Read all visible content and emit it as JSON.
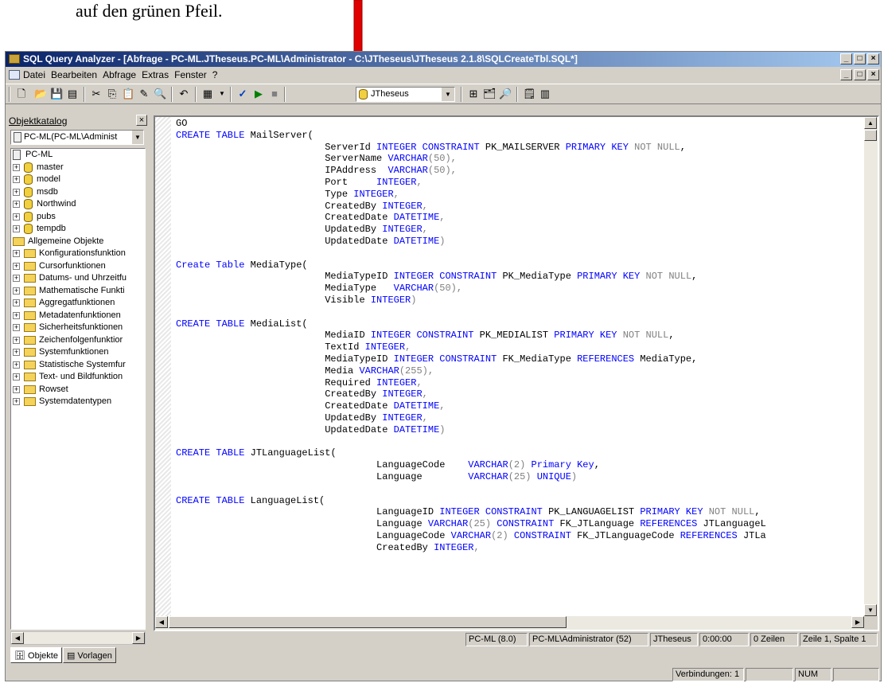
{
  "caption": "auf den grünen Pfeil.",
  "colors": {
    "arrow": "#e00000",
    "title_start": "#0a246a",
    "title_end": "#a6caf0",
    "keyword": "#0000ff"
  },
  "window": {
    "title": "SQL Query Analyzer - [Abfrage - PC-ML.JTheseus.PC-ML\\Administrator - C:\\JTheseus\\JTheseus 2.1.8\\SQLCreateTbl.SQL*]",
    "caption_buttons": [
      "_",
      "□",
      "×"
    ]
  },
  "menu": {
    "items": [
      "Datei",
      "Bearbeiten",
      "Abfrage",
      "Extras",
      "Fenster",
      "?"
    ]
  },
  "toolbar": {
    "database": "JTheseus"
  },
  "object_browser": {
    "title": "Objektkatalog",
    "close": "×",
    "server": "PC-ML(PC-ML\\Administ",
    "tree": [
      {
        "label": "PC-ML",
        "level": 0,
        "icon": "server-icon",
        "expander": ""
      },
      {
        "label": "master",
        "level": 1,
        "icon": "database-icon",
        "expander": "+"
      },
      {
        "label": "model",
        "level": 1,
        "icon": "database-icon",
        "expander": "+"
      },
      {
        "label": "msdb",
        "level": 1,
        "icon": "database-icon",
        "expander": "+"
      },
      {
        "label": "Northwind",
        "level": 1,
        "icon": "database-icon",
        "expander": "+"
      },
      {
        "label": "pubs",
        "level": 1,
        "icon": "database-icon",
        "expander": "+"
      },
      {
        "label": "tempdb",
        "level": 1,
        "icon": "database-icon",
        "expander": "+"
      },
      {
        "label": "Allgemeine Objekte",
        "level": 0,
        "icon": "folder-icon",
        "expander": ""
      },
      {
        "label": "Konfigurationsfunktion",
        "level": 1,
        "icon": "folder-icon",
        "expander": "+"
      },
      {
        "label": "Cursorfunktionen",
        "level": 1,
        "icon": "folder-icon",
        "expander": "+"
      },
      {
        "label": "Datums- und Uhrzeitfu",
        "level": 1,
        "icon": "folder-icon",
        "expander": "+"
      },
      {
        "label": "Mathematische Funkti",
        "level": 1,
        "icon": "folder-icon",
        "expander": "+"
      },
      {
        "label": "Aggregatfunktionen",
        "level": 1,
        "icon": "folder-icon",
        "expander": "+"
      },
      {
        "label": "Metadatenfunktionen",
        "level": 1,
        "icon": "folder-icon",
        "expander": "+"
      },
      {
        "label": "Sicherheitsfunktionen",
        "level": 1,
        "icon": "folder-icon",
        "expander": "+"
      },
      {
        "label": "Zeichenfolgenfunktior",
        "level": 1,
        "icon": "folder-icon",
        "expander": "+"
      },
      {
        "label": "Systemfunktionen",
        "level": 1,
        "icon": "folder-icon",
        "expander": "+"
      },
      {
        "label": "Statistische Systemfur",
        "level": 1,
        "icon": "folder-icon",
        "expander": "+"
      },
      {
        "label": "Text- und Bildfunktion",
        "level": 1,
        "icon": "folder-icon",
        "expander": "+"
      },
      {
        "label": "Rowset",
        "level": 1,
        "icon": "folder-icon",
        "expander": "+"
      },
      {
        "label": "Systemdatentypen",
        "level": 1,
        "icon": "folder-icon",
        "expander": "+"
      }
    ],
    "tabs": [
      "Objekte",
      "Vorlagen"
    ]
  },
  "editor": {
    "lines": [
      [
        [
          "GO",
          "t"
        ]
      ],
      [
        [
          "CREATE TABLE",
          "k"
        ],
        [
          " MailServer(",
          "t"
        ]
      ],
      [
        [
          "                          ServerId ",
          "t"
        ],
        [
          "INTEGER CONSTRAINT",
          "k"
        ],
        [
          " PK_MAILSERVER ",
          "t"
        ],
        [
          "PRIMARY KEY",
          "k"
        ],
        [
          " NOT NULL",
          "g"
        ],
        [
          ",",
          "t"
        ]
      ],
      [
        [
          "                          ServerName ",
          "t"
        ],
        [
          "VARCHAR",
          "k"
        ],
        [
          "(50),",
          "g"
        ]
      ],
      [
        [
          "                          IPAddress  ",
          "t"
        ],
        [
          "VARCHAR",
          "k"
        ],
        [
          "(50),",
          "g"
        ]
      ],
      [
        [
          "                          Port     ",
          "t"
        ],
        [
          "INTEGER",
          "k"
        ],
        [
          ",",
          "g"
        ]
      ],
      [
        [
          "                          Type ",
          "t"
        ],
        [
          "INTEGER",
          "k"
        ],
        [
          ",",
          "g"
        ]
      ],
      [
        [
          "                          CreatedBy ",
          "t"
        ],
        [
          "INTEGER",
          "k"
        ],
        [
          ",",
          "g"
        ]
      ],
      [
        [
          "                          CreatedDate ",
          "t"
        ],
        [
          "DATETIME",
          "k"
        ],
        [
          ",",
          "g"
        ]
      ],
      [
        [
          "                          UpdatedBy ",
          "t"
        ],
        [
          "INTEGER",
          "k"
        ],
        [
          ",",
          "g"
        ]
      ],
      [
        [
          "                          UpdatedDate ",
          "t"
        ],
        [
          "DATETIME",
          "k"
        ],
        [
          ")",
          "g"
        ]
      ],
      [],
      [
        [
          "Create Table",
          "k"
        ],
        [
          " MediaType(",
          "t"
        ]
      ],
      [
        [
          "                          MediaTypeID ",
          "t"
        ],
        [
          "INTEGER CONSTRAINT",
          "k"
        ],
        [
          " PK_MediaType ",
          "t"
        ],
        [
          "PRIMARY KEY",
          "k"
        ],
        [
          " NOT NULL",
          "g"
        ],
        [
          ",",
          "t"
        ]
      ],
      [
        [
          "                          MediaType   ",
          "t"
        ],
        [
          "VARCHAR",
          "k"
        ],
        [
          "(50),",
          "g"
        ]
      ],
      [
        [
          "                          Visible ",
          "t"
        ],
        [
          "INTEGER",
          "k"
        ],
        [
          ")",
          "g"
        ]
      ],
      [],
      [
        [
          "CREATE TABLE",
          "k"
        ],
        [
          " MediaList(",
          "t"
        ]
      ],
      [
        [
          "                          MediaID ",
          "t"
        ],
        [
          "INTEGER CONSTRAINT",
          "k"
        ],
        [
          " PK_MEDIALIST ",
          "t"
        ],
        [
          "PRIMARY KEY",
          "k"
        ],
        [
          " NOT NULL",
          "g"
        ],
        [
          ",",
          "t"
        ]
      ],
      [
        [
          "                          TextId ",
          "t"
        ],
        [
          "INTEGER",
          "k"
        ],
        [
          ",",
          "g"
        ]
      ],
      [
        [
          "                          MediaTypeID ",
          "t"
        ],
        [
          "INTEGER CONSTRAINT",
          "k"
        ],
        [
          " FK_MediaType ",
          "t"
        ],
        [
          "REFERENCES",
          "k"
        ],
        [
          " MediaType,",
          "t"
        ]
      ],
      [
        [
          "                          Media ",
          "t"
        ],
        [
          "VARCHAR",
          "k"
        ],
        [
          "(255),",
          "g"
        ]
      ],
      [
        [
          "                          Required ",
          "t"
        ],
        [
          "INTEGER",
          "k"
        ],
        [
          ",",
          "g"
        ]
      ],
      [
        [
          "                          CreatedBy ",
          "t"
        ],
        [
          "INTEGER",
          "k"
        ],
        [
          ",",
          "g"
        ]
      ],
      [
        [
          "                          CreatedDate ",
          "t"
        ],
        [
          "DATETIME",
          "k"
        ],
        [
          ",",
          "g"
        ]
      ],
      [
        [
          "                          UpdatedBy ",
          "t"
        ],
        [
          "INTEGER",
          "k"
        ],
        [
          ",",
          "g"
        ]
      ],
      [
        [
          "                          UpdatedDate ",
          "t"
        ],
        [
          "DATETIME",
          "k"
        ],
        [
          ")",
          "g"
        ]
      ],
      [],
      [
        [
          "CREATE TABLE",
          "k"
        ],
        [
          " JTLanguageList(",
          "t"
        ]
      ],
      [
        [
          "                                   LanguageCode    ",
          "t"
        ],
        [
          "VARCHAR",
          "k"
        ],
        [
          "(2) ",
          "g"
        ],
        [
          "Primary Key",
          "k"
        ],
        [
          ",",
          "t"
        ]
      ],
      [
        [
          "                                   Language        ",
          "t"
        ],
        [
          "VARCHAR",
          "k"
        ],
        [
          "(25) ",
          "g"
        ],
        [
          "UNIQUE",
          "k"
        ],
        [
          ")",
          "g"
        ]
      ],
      [],
      [
        [
          "CREATE TABLE",
          "k"
        ],
        [
          " LanguageList(",
          "t"
        ]
      ],
      [
        [
          "                                   LanguageID ",
          "t"
        ],
        [
          "INTEGER CONSTRAINT",
          "k"
        ],
        [
          " PK_LANGUAGELIST ",
          "t"
        ],
        [
          "PRIMARY KEY",
          "k"
        ],
        [
          " NOT NULL",
          "g"
        ],
        [
          ",",
          "t"
        ]
      ],
      [
        [
          "                                   Language ",
          "t"
        ],
        [
          "VARCHAR",
          "k"
        ],
        [
          "(25) ",
          "g"
        ],
        [
          "CONSTRAINT",
          "k"
        ],
        [
          " FK_JTLanguage ",
          "t"
        ],
        [
          "REFERENCES",
          "k"
        ],
        [
          " JTLanguageL",
          "t"
        ]
      ],
      [
        [
          "                                   LanguageCode ",
          "t"
        ],
        [
          "VARCHAR",
          "k"
        ],
        [
          "(2) ",
          "g"
        ],
        [
          "CONSTRAINT",
          "k"
        ],
        [
          " FK_JTLanguageCode ",
          "t"
        ],
        [
          "REFERENCES",
          "k"
        ],
        [
          " JTLa",
          "t"
        ]
      ],
      [
        [
          "                                   CreatedBy ",
          "t"
        ],
        [
          "INTEGER",
          "k"
        ],
        [
          ",",
          "g"
        ]
      ]
    ]
  },
  "status": {
    "server": "PC-ML (8.0)",
    "user": "PC-ML\\Administrator (52)",
    "database": "JTheseus",
    "time": "0:00:00",
    "rows": "0 Zeilen",
    "position": "Zeile 1, Spalte 1",
    "connections": "Verbindungen: 1",
    "num": "NUM"
  }
}
